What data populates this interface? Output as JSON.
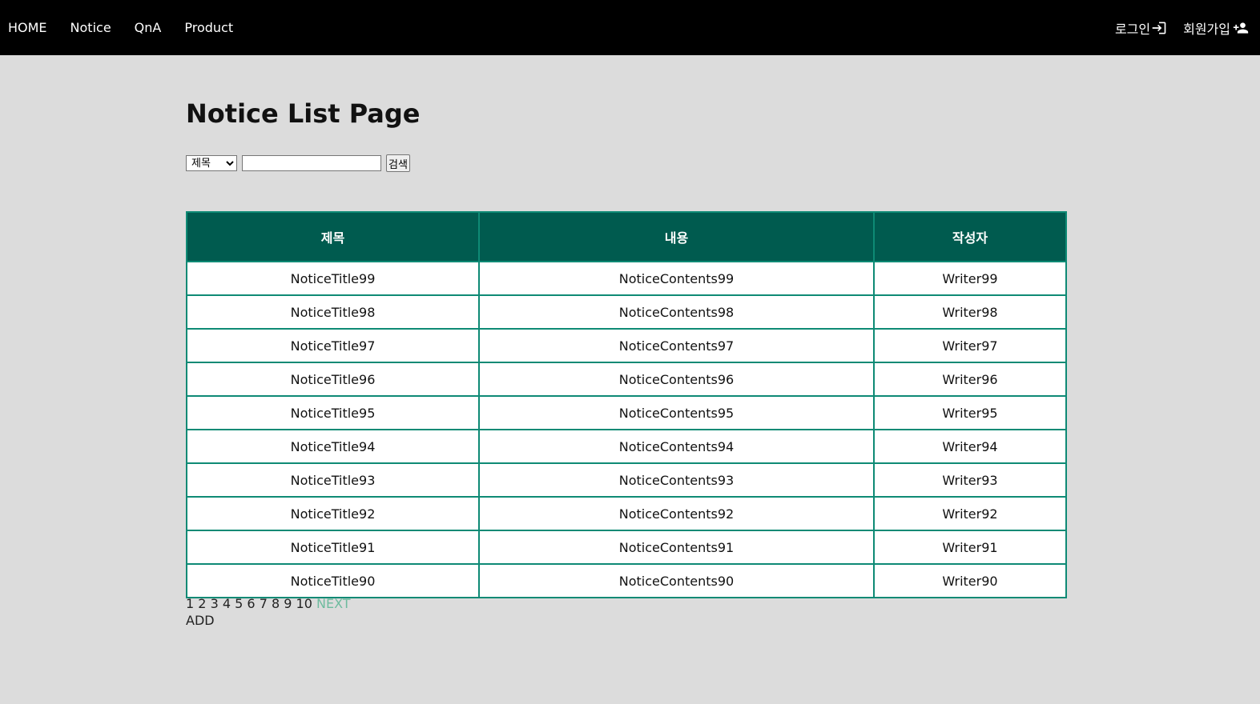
{
  "nav": {
    "home": "HOME",
    "notice": "Notice",
    "qna": "QnA",
    "product": "Product",
    "login": "로그인",
    "join": "회원가입"
  },
  "page": {
    "title": "Notice List Page"
  },
  "search": {
    "kind_selected": "제목",
    "query": "",
    "button": "검색"
  },
  "table": {
    "headers": [
      "제목",
      "내용",
      "작성자"
    ],
    "rows": [
      [
        "NoticeTitle99",
        "NoticeContents99",
        "Writer99"
      ],
      [
        "NoticeTitle98",
        "NoticeContents98",
        "Writer98"
      ],
      [
        "NoticeTitle97",
        "NoticeContents97",
        "Writer97"
      ],
      [
        "NoticeTitle96",
        "NoticeContents96",
        "Writer96"
      ],
      [
        "NoticeTitle95",
        "NoticeContents95",
        "Writer95"
      ],
      [
        "NoticeTitle94",
        "NoticeContents94",
        "Writer94"
      ],
      [
        "NoticeTitle93",
        "NoticeContents93",
        "Writer93"
      ],
      [
        "NoticeTitle92",
        "NoticeContents92",
        "Writer92"
      ],
      [
        "NoticeTitle91",
        "NoticeContents91",
        "Writer91"
      ],
      [
        "NoticeTitle90",
        "NoticeContents90",
        "Writer90"
      ]
    ]
  },
  "pagination": {
    "pages": [
      "1",
      "2",
      "3",
      "4",
      "5",
      "6",
      "7",
      "8",
      "9",
      "10"
    ],
    "next": "NEXT"
  },
  "actions": {
    "add": "ADD"
  },
  "colors": {
    "nav_bg": "#000000",
    "page_bg": "#dcdcdc",
    "header_bg": "#005b4f",
    "border": "#0e8a75",
    "next_link": "#6dbb9e"
  },
  "icons": {
    "login": "login-arrow-icon",
    "join": "person-add-icon"
  }
}
